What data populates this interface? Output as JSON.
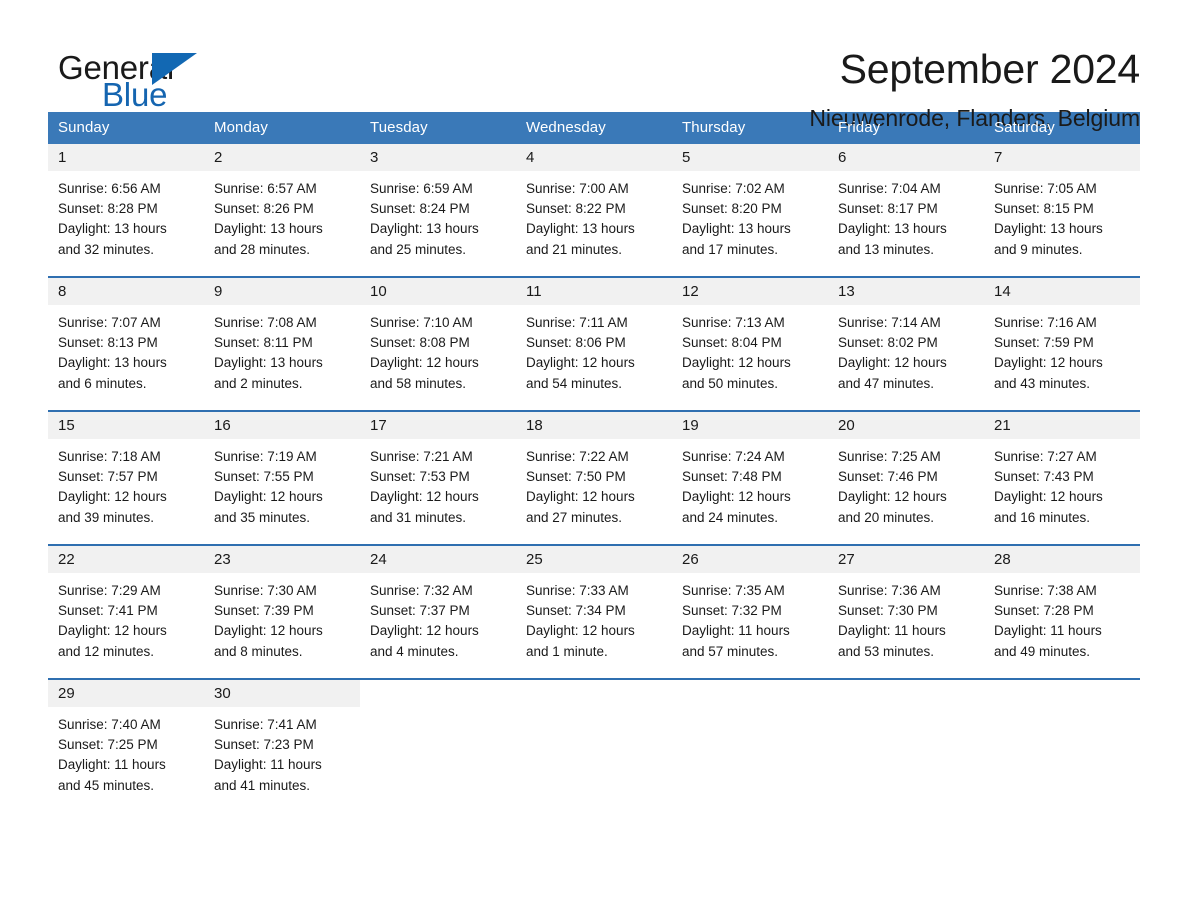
{
  "brand": {
    "name_part1": "General",
    "name_part2": "Blue",
    "accent_color": "#1268b3"
  },
  "header": {
    "title": "September 2024",
    "subtitle": "Nieuwenrode, Flanders, Belgium"
  },
  "calendar": {
    "header_bg": "#3a79b8",
    "daynum_bg": "#f1f1f1",
    "row_divider": "#2f6fb0",
    "weekday_headers": [
      "Sunday",
      "Monday",
      "Tuesday",
      "Wednesday",
      "Thursday",
      "Friday",
      "Saturday"
    ],
    "weeks": [
      [
        {
          "day": "1",
          "sunrise": "Sunrise: 6:56 AM",
          "sunset": "Sunset: 8:28 PM",
          "daylight_line1": "Daylight: 13 hours",
          "daylight_line2": "and 32 minutes."
        },
        {
          "day": "2",
          "sunrise": "Sunrise: 6:57 AM",
          "sunset": "Sunset: 8:26 PM",
          "daylight_line1": "Daylight: 13 hours",
          "daylight_line2": "and 28 minutes."
        },
        {
          "day": "3",
          "sunrise": "Sunrise: 6:59 AM",
          "sunset": "Sunset: 8:24 PM",
          "daylight_line1": "Daylight: 13 hours",
          "daylight_line2": "and 25 minutes."
        },
        {
          "day": "4",
          "sunrise": "Sunrise: 7:00 AM",
          "sunset": "Sunset: 8:22 PM",
          "daylight_line1": "Daylight: 13 hours",
          "daylight_line2": "and 21 minutes."
        },
        {
          "day": "5",
          "sunrise": "Sunrise: 7:02 AM",
          "sunset": "Sunset: 8:20 PM",
          "daylight_line1": "Daylight: 13 hours",
          "daylight_line2": "and 17 minutes."
        },
        {
          "day": "6",
          "sunrise": "Sunrise: 7:04 AM",
          "sunset": "Sunset: 8:17 PM",
          "daylight_line1": "Daylight: 13 hours",
          "daylight_line2": "and 13 minutes."
        },
        {
          "day": "7",
          "sunrise": "Sunrise: 7:05 AM",
          "sunset": "Sunset: 8:15 PM",
          "daylight_line1": "Daylight: 13 hours",
          "daylight_line2": "and 9 minutes."
        }
      ],
      [
        {
          "day": "8",
          "sunrise": "Sunrise: 7:07 AM",
          "sunset": "Sunset: 8:13 PM",
          "daylight_line1": "Daylight: 13 hours",
          "daylight_line2": "and 6 minutes."
        },
        {
          "day": "9",
          "sunrise": "Sunrise: 7:08 AM",
          "sunset": "Sunset: 8:11 PM",
          "daylight_line1": "Daylight: 13 hours",
          "daylight_line2": "and 2 minutes."
        },
        {
          "day": "10",
          "sunrise": "Sunrise: 7:10 AM",
          "sunset": "Sunset: 8:08 PM",
          "daylight_line1": "Daylight: 12 hours",
          "daylight_line2": "and 58 minutes."
        },
        {
          "day": "11",
          "sunrise": "Sunrise: 7:11 AM",
          "sunset": "Sunset: 8:06 PM",
          "daylight_line1": "Daylight: 12 hours",
          "daylight_line2": "and 54 minutes."
        },
        {
          "day": "12",
          "sunrise": "Sunrise: 7:13 AM",
          "sunset": "Sunset: 8:04 PM",
          "daylight_line1": "Daylight: 12 hours",
          "daylight_line2": "and 50 minutes."
        },
        {
          "day": "13",
          "sunrise": "Sunrise: 7:14 AM",
          "sunset": "Sunset: 8:02 PM",
          "daylight_line1": "Daylight: 12 hours",
          "daylight_line2": "and 47 minutes."
        },
        {
          "day": "14",
          "sunrise": "Sunrise: 7:16 AM",
          "sunset": "Sunset: 7:59 PM",
          "daylight_line1": "Daylight: 12 hours",
          "daylight_line2": "and 43 minutes."
        }
      ],
      [
        {
          "day": "15",
          "sunrise": "Sunrise: 7:18 AM",
          "sunset": "Sunset: 7:57 PM",
          "daylight_line1": "Daylight: 12 hours",
          "daylight_line2": "and 39 minutes."
        },
        {
          "day": "16",
          "sunrise": "Sunrise: 7:19 AM",
          "sunset": "Sunset: 7:55 PM",
          "daylight_line1": "Daylight: 12 hours",
          "daylight_line2": "and 35 minutes."
        },
        {
          "day": "17",
          "sunrise": "Sunrise: 7:21 AM",
          "sunset": "Sunset: 7:53 PM",
          "daylight_line1": "Daylight: 12 hours",
          "daylight_line2": "and 31 minutes."
        },
        {
          "day": "18",
          "sunrise": "Sunrise: 7:22 AM",
          "sunset": "Sunset: 7:50 PM",
          "daylight_line1": "Daylight: 12 hours",
          "daylight_line2": "and 27 minutes."
        },
        {
          "day": "19",
          "sunrise": "Sunrise: 7:24 AM",
          "sunset": "Sunset: 7:48 PM",
          "daylight_line1": "Daylight: 12 hours",
          "daylight_line2": "and 24 minutes."
        },
        {
          "day": "20",
          "sunrise": "Sunrise: 7:25 AM",
          "sunset": "Sunset: 7:46 PM",
          "daylight_line1": "Daylight: 12 hours",
          "daylight_line2": "and 20 minutes."
        },
        {
          "day": "21",
          "sunrise": "Sunrise: 7:27 AM",
          "sunset": "Sunset: 7:43 PM",
          "daylight_line1": "Daylight: 12 hours",
          "daylight_line2": "and 16 minutes."
        }
      ],
      [
        {
          "day": "22",
          "sunrise": "Sunrise: 7:29 AM",
          "sunset": "Sunset: 7:41 PM",
          "daylight_line1": "Daylight: 12 hours",
          "daylight_line2": "and 12 minutes."
        },
        {
          "day": "23",
          "sunrise": "Sunrise: 7:30 AM",
          "sunset": "Sunset: 7:39 PM",
          "daylight_line1": "Daylight: 12 hours",
          "daylight_line2": "and 8 minutes."
        },
        {
          "day": "24",
          "sunrise": "Sunrise: 7:32 AM",
          "sunset": "Sunset: 7:37 PM",
          "daylight_line1": "Daylight: 12 hours",
          "daylight_line2": "and 4 minutes."
        },
        {
          "day": "25",
          "sunrise": "Sunrise: 7:33 AM",
          "sunset": "Sunset: 7:34 PM",
          "daylight_line1": "Daylight: 12 hours",
          "daylight_line2": "and 1 minute."
        },
        {
          "day": "26",
          "sunrise": "Sunrise: 7:35 AM",
          "sunset": "Sunset: 7:32 PM",
          "daylight_line1": "Daylight: 11 hours",
          "daylight_line2": "and 57 minutes."
        },
        {
          "day": "27",
          "sunrise": "Sunrise: 7:36 AM",
          "sunset": "Sunset: 7:30 PM",
          "daylight_line1": "Daylight: 11 hours",
          "daylight_line2": "and 53 minutes."
        },
        {
          "day": "28",
          "sunrise": "Sunrise: 7:38 AM",
          "sunset": "Sunset: 7:28 PM",
          "daylight_line1": "Daylight: 11 hours",
          "daylight_line2": "and 49 minutes."
        }
      ],
      [
        {
          "day": "29",
          "sunrise": "Sunrise: 7:40 AM",
          "sunset": "Sunset: 7:25 PM",
          "daylight_line1": "Daylight: 11 hours",
          "daylight_line2": "and 45 minutes."
        },
        {
          "day": "30",
          "sunrise": "Sunrise: 7:41 AM",
          "sunset": "Sunset: 7:23 PM",
          "daylight_line1": "Daylight: 11 hours",
          "daylight_line2": "and 41 minutes."
        },
        {
          "day": "",
          "sunrise": "",
          "sunset": "",
          "daylight_line1": "",
          "daylight_line2": ""
        },
        {
          "day": "",
          "sunrise": "",
          "sunset": "",
          "daylight_line1": "",
          "daylight_line2": ""
        },
        {
          "day": "",
          "sunrise": "",
          "sunset": "",
          "daylight_line1": "",
          "daylight_line2": ""
        },
        {
          "day": "",
          "sunrise": "",
          "sunset": "",
          "daylight_line1": "",
          "daylight_line2": ""
        },
        {
          "day": "",
          "sunrise": "",
          "sunset": "",
          "daylight_line1": "",
          "daylight_line2": ""
        }
      ]
    ]
  }
}
